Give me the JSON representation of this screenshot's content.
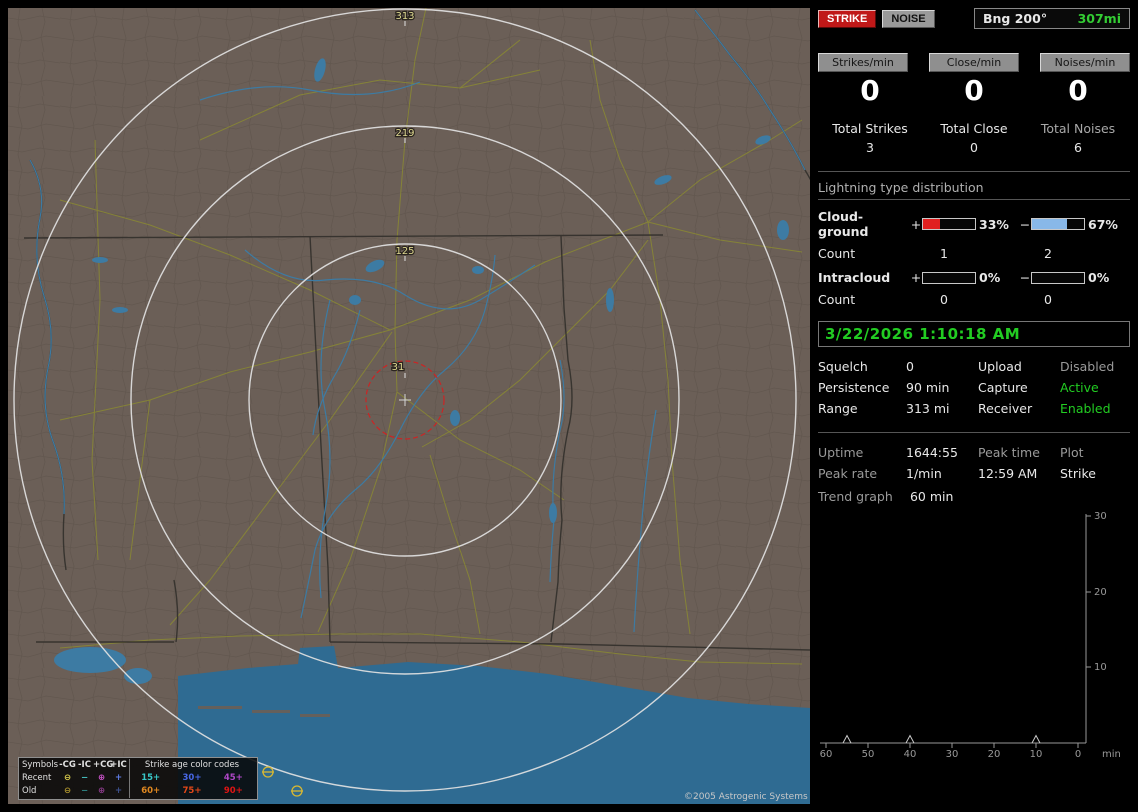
{
  "window": {
    "copyright": "©2005 Astrogenic Systems"
  },
  "colors": {
    "strike_red": "#c01818",
    "noise_gray": "#9a9a9a",
    "active_green": "#22cc22",
    "bearing_green": "#33cc33",
    "bar_red": "#e02020",
    "bar_blue": "#88b8e8",
    "map_land": "#6b5f57",
    "water": "#2f6b92",
    "road_yellow": "#8c8c30",
    "range_ring": "#e2e2e2",
    "alarm_circle": "#cc2424",
    "strike_marker": "#d8b832"
  },
  "map": {
    "range_labels": [
      "313",
      "219",
      "125",
      "31"
    ],
    "strike_markers": [
      {
        "symbol": "-CG",
        "age": "old"
      },
      {
        "symbol": "-CG",
        "age": "old"
      }
    ],
    "legend": {
      "symbols_title": "Symbols",
      "columns": [
        "-CG",
        "-IC",
        "+CG",
        "+IC"
      ],
      "age_title": "Strike age color codes",
      "icon_glyphs": [
        "⊖",
        "−",
        "⊕",
        "+"
      ],
      "rows": [
        {
          "label": "Recent",
          "icon_colors": [
            "#e2d44e",
            "#46c2c2",
            "#d055d0",
            "#5f7de8"
          ],
          "ages": [
            {
              "text": "15+",
              "color": "#38c8c8"
            },
            {
              "text": "30+",
              "color": "#4868e8"
            },
            {
              "text": "45+",
              "color": "#b048c8"
            }
          ]
        },
        {
          "label": "Old",
          "icon_colors": [
            "#b2982e",
            "#2e8484",
            "#8e3c8e",
            "#3e5290"
          ],
          "ages": [
            {
              "text": "60+",
              "color": "#e08820"
            },
            {
              "text": "75+",
              "color": "#e44818"
            },
            {
              "text": "90+",
              "color": "#e01414"
            }
          ]
        }
      ]
    }
  },
  "panel": {
    "strike_button": "STRIKE",
    "noise_button": "NOISE",
    "bearing": {
      "label": "Bng 200°",
      "value": "307mi"
    },
    "rates": [
      {
        "label": "Strikes/min",
        "value": "0"
      },
      {
        "label": "Close/min",
        "value": "0"
      },
      {
        "label": "Noises/min",
        "value": "0"
      }
    ],
    "totals": [
      {
        "label": "Total Strikes",
        "value": "3"
      },
      {
        "label": "Total Close",
        "value": "0"
      },
      {
        "label": "Total Noises",
        "value": "6"
      }
    ],
    "distribution": {
      "title": "Lightning type distribution",
      "count_label": "Count",
      "plus_sign": "+",
      "minus_sign": "−",
      "rows": [
        {
          "label": "Cloud-ground",
          "plus_pct": "33%",
          "minus_pct": "67%",
          "plus_fill": 33,
          "minus_fill": 67,
          "plus_count": "1",
          "minus_count": "2"
        },
        {
          "label": "Intracloud",
          "plus_pct": "0%",
          "minus_pct": "0%",
          "plus_fill": 0,
          "minus_fill": 0,
          "plus_count": "0",
          "minus_count": "0"
        }
      ]
    },
    "clock": "3/22/2026 1:10:18 AM",
    "status_rows": [
      {
        "label1": "Squelch",
        "value1": "0",
        "label2": "Upload",
        "value2": "Disabled",
        "state": "disabled"
      },
      {
        "label1": "Persistence",
        "value1": "90 min",
        "label2": "Capture",
        "value2": "Active",
        "state": "active"
      },
      {
        "label1": "Range",
        "value1": "313 mi",
        "label2": "Receiver",
        "value2": "Enabled",
        "state": "active"
      }
    ],
    "stats_rows": [
      {
        "c1": "Uptime",
        "c2": "1644:55",
        "c3": "Peak time",
        "c4": "Plot"
      },
      {
        "c1": "Peak rate",
        "c2": "1/min",
        "c3": "12:59 AM",
        "c4": "Strike"
      }
    ],
    "trend_label": "Trend graph",
    "trend_value": "60 min"
  },
  "chart_data": {
    "type": "line",
    "title": "Trend graph — strikes per minute over last 60 minutes",
    "xlabel": "min",
    "x_unit": "min",
    "x_ticks": [
      "60",
      "50",
      "40",
      "30",
      "20",
      "10",
      "0"
    ],
    "ylim": [
      0,
      30
    ],
    "y_ticks": [
      "30",
      "20",
      "10"
    ],
    "grid": false,
    "series": [
      {
        "name": "Strike",
        "points": [
          {
            "min_ago": 55,
            "value": 1
          },
          {
            "min_ago": 40,
            "value": 1
          },
          {
            "min_ago": 10,
            "value": 1
          }
        ]
      }
    ]
  }
}
